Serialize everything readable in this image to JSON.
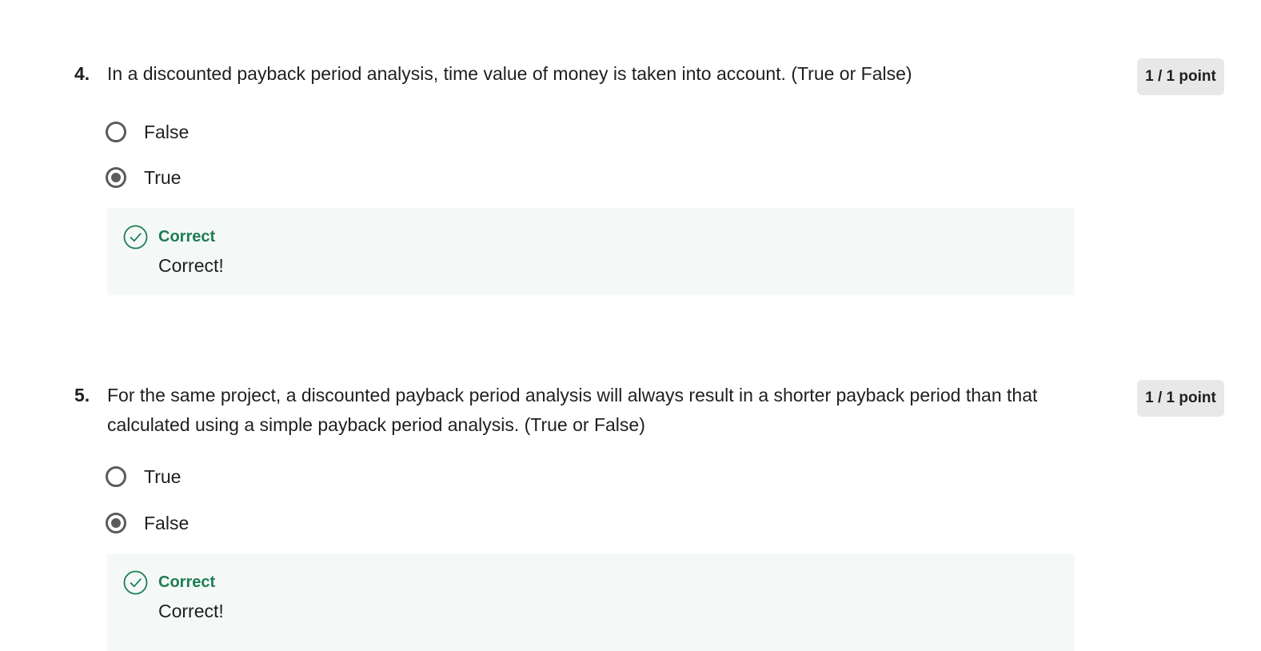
{
  "questions": [
    {
      "number": "4.",
      "text": "In a discounted payback period analysis, time value of money is taken into account. (True or False)",
      "points": "1 / 1 point",
      "options": [
        {
          "label": "False",
          "selected": false
        },
        {
          "label": "True",
          "selected": true
        }
      ],
      "feedback": {
        "title": "Correct",
        "text": "Correct!"
      }
    },
    {
      "number": "5.",
      "text": "For the same project, a discounted payback period analysis will always result in a shorter payback period than that calculated using a simple payback period analysis. (True or False)",
      "points": "1 / 1 point",
      "options": [
        {
          "label": "True",
          "selected": false
        },
        {
          "label": "False",
          "selected": true
        }
      ],
      "feedback": {
        "title": "Correct",
        "text": "Correct!"
      }
    }
  ],
  "colors": {
    "correct_green": "#1e7d54",
    "feedback_bg": "#f4f9f7",
    "badge_bg": "#e8e8e8",
    "radio_gray": "#5b5b5b"
  },
  "icons": {
    "feedback": "check-circle-icon"
  }
}
